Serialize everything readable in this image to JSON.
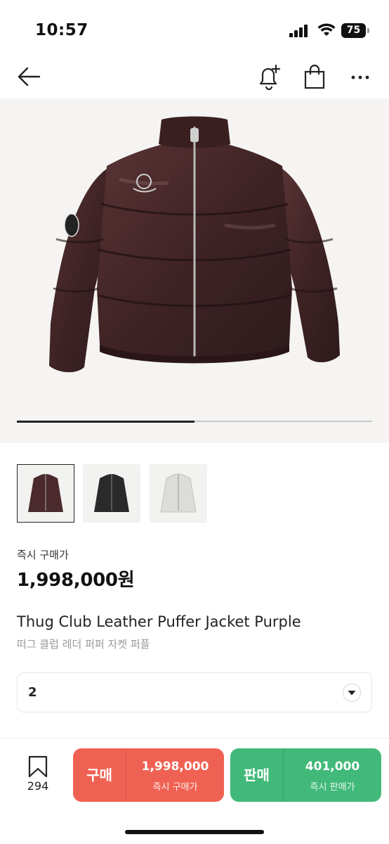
{
  "status_bar": {
    "time": "10:57",
    "battery": "75",
    "icons": [
      "signal-icon",
      "wifi-icon",
      "battery-icon"
    ]
  },
  "nav": {
    "icons": [
      "back-arrow-icon",
      "bell-plus-icon",
      "shopping-bag-icon",
      "more-icon"
    ]
  },
  "gallery": {
    "current_image": 1,
    "total_images": 2,
    "progress_fraction": 0.5,
    "thumbnails": [
      {
        "color": "#4a2a2c",
        "selected": true
      },
      {
        "color": "#2a2a2a",
        "selected": false
      },
      {
        "color": "#dcdcd8",
        "selected": false
      }
    ]
  },
  "product": {
    "price_label": "즉시 구매가",
    "price": "1,998,000원",
    "title": "Thug Club Leather Puffer Jacket Purple",
    "title_ko": "떠그 클럽 레더 퍼퍼 자켓 퍼플",
    "size": "2"
  },
  "bottom_bar": {
    "bookmark_count": "294",
    "buy": {
      "label": "구매",
      "price": "1,998,000",
      "sub": "즉시 구매가",
      "color": "#ef6253"
    },
    "sell": {
      "label": "판매",
      "price": "401,000",
      "sub": "즉시 판매가",
      "color": "#41b979"
    }
  }
}
